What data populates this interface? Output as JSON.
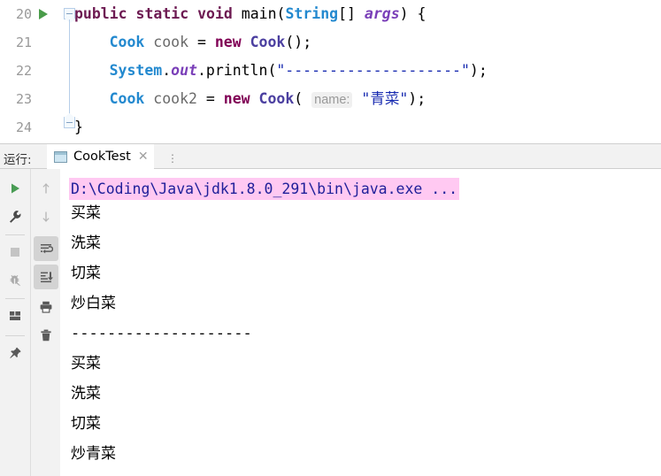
{
  "editor": {
    "lines": [
      {
        "number": "20",
        "has_run_marker": true,
        "tokens": [
          {
            "text": "public",
            "cls": "modifier"
          },
          {
            "text": " ",
            "cls": "punc"
          },
          {
            "text": "static",
            "cls": "modifier"
          },
          {
            "text": " ",
            "cls": "punc"
          },
          {
            "text": "void",
            "cls": "modifier"
          },
          {
            "text": " ",
            "cls": "punc"
          },
          {
            "text": "main",
            "cls": "method"
          },
          {
            "text": "(",
            "cls": "punc"
          },
          {
            "text": "String",
            "cls": "type"
          },
          {
            "text": "[] ",
            "cls": "punc"
          },
          {
            "text": "args",
            "cls": "fieldref"
          },
          {
            "text": ") {",
            "cls": "punc"
          }
        ]
      },
      {
        "number": "21",
        "has_run_marker": false,
        "indent": 4,
        "tokens": [
          {
            "text": "Cook",
            "cls": "type"
          },
          {
            "text": " ",
            "cls": "punc"
          },
          {
            "text": "cook",
            "cls": "ident"
          },
          {
            "text": " = ",
            "cls": "punc"
          },
          {
            "text": "new",
            "cls": "newkw"
          },
          {
            "text": " ",
            "cls": "punc"
          },
          {
            "text": "Cook",
            "cls": "clsref"
          },
          {
            "text": "();",
            "cls": "punc"
          }
        ]
      },
      {
        "number": "22",
        "has_run_marker": false,
        "indent": 4,
        "tokens": [
          {
            "text": "System",
            "cls": "type"
          },
          {
            "text": ".",
            "cls": "punc"
          },
          {
            "text": "out",
            "cls": "fieldref"
          },
          {
            "text": ".",
            "cls": "punc"
          },
          {
            "text": "println",
            "cls": "method"
          },
          {
            "text": "(",
            "cls": "punc"
          },
          {
            "text": "\"--------------------\"",
            "cls": "str"
          },
          {
            "text": ");",
            "cls": "punc"
          }
        ]
      },
      {
        "number": "23",
        "has_run_marker": false,
        "indent": 4,
        "tokens": [
          {
            "text": "Cook",
            "cls": "type"
          },
          {
            "text": " ",
            "cls": "punc"
          },
          {
            "text": "cook2",
            "cls": "ident"
          },
          {
            "text": " = ",
            "cls": "punc"
          },
          {
            "text": "new",
            "cls": "newkw"
          },
          {
            "text": " ",
            "cls": "punc"
          },
          {
            "text": "Cook",
            "cls": "clsref"
          },
          {
            "text": "( ",
            "cls": "punc"
          },
          {
            "text": "name:",
            "cls": "hint"
          },
          {
            "text": " ",
            "cls": "punc"
          },
          {
            "text": "\"青菜\"",
            "cls": "str"
          },
          {
            "text": ");",
            "cls": "punc"
          }
        ]
      },
      {
        "number": "24",
        "has_run_marker": false,
        "tokens": [
          {
            "text": "}",
            "cls": "punc"
          }
        ]
      }
    ]
  },
  "toolwindow": {
    "label": "运行:",
    "tab_label": "CookTest",
    "tab_close": "✕",
    "tab_overflow": "⋮"
  },
  "toolbar_left": [
    {
      "name": "rerun-button",
      "icon": "play-icon",
      "title": "Rerun"
    },
    {
      "name": "edit-configuration-button",
      "icon": "wrench-icon",
      "title": "Edit Configuration"
    },
    {
      "name": "stop-button",
      "icon": "stop-icon",
      "title": "Stop"
    },
    {
      "name": "debug-button",
      "icon": "bug-icon",
      "title": "Debug",
      "disabled": true
    },
    {
      "name": "layout-button",
      "icon": "layout-icon",
      "title": "Layout Settings"
    },
    {
      "name": "pin-button",
      "icon": "pin-icon",
      "title": "Pin Tab"
    }
  ],
  "toolbar_right": [
    {
      "name": "up-button",
      "icon": "arrow-up-icon",
      "title": "Up the Stack Trace",
      "disabled": true
    },
    {
      "name": "down-button",
      "icon": "arrow-down-icon",
      "title": "Down the Stack Trace",
      "disabled": true
    },
    {
      "name": "soft-wrap-button",
      "icon": "soft-wrap-icon",
      "title": "Use Soft Wraps",
      "active": true
    },
    {
      "name": "scroll-to-end-button",
      "icon": "scroll-to-end-icon",
      "title": "Scroll to the End",
      "active": true
    },
    {
      "name": "print-button",
      "icon": "printer-icon",
      "title": "Print"
    },
    {
      "name": "clear-all-button",
      "icon": "trash-icon",
      "title": "Clear All"
    }
  ],
  "console": {
    "command_line": "D:\\Coding\\Java\\jdk1.8.0_291\\bin\\java.exe ...",
    "output": [
      "买菜",
      "洗菜",
      "切菜",
      "炒白菜",
      "--------------------",
      "买菜",
      "洗菜",
      "切菜",
      "炒青菜"
    ]
  },
  "colors": {
    "command_highlight": "#ffc9f2",
    "command_text": "#20209a",
    "toolbar_bg": "#f2f2f2",
    "run_marker": "#4a9c4a"
  }
}
